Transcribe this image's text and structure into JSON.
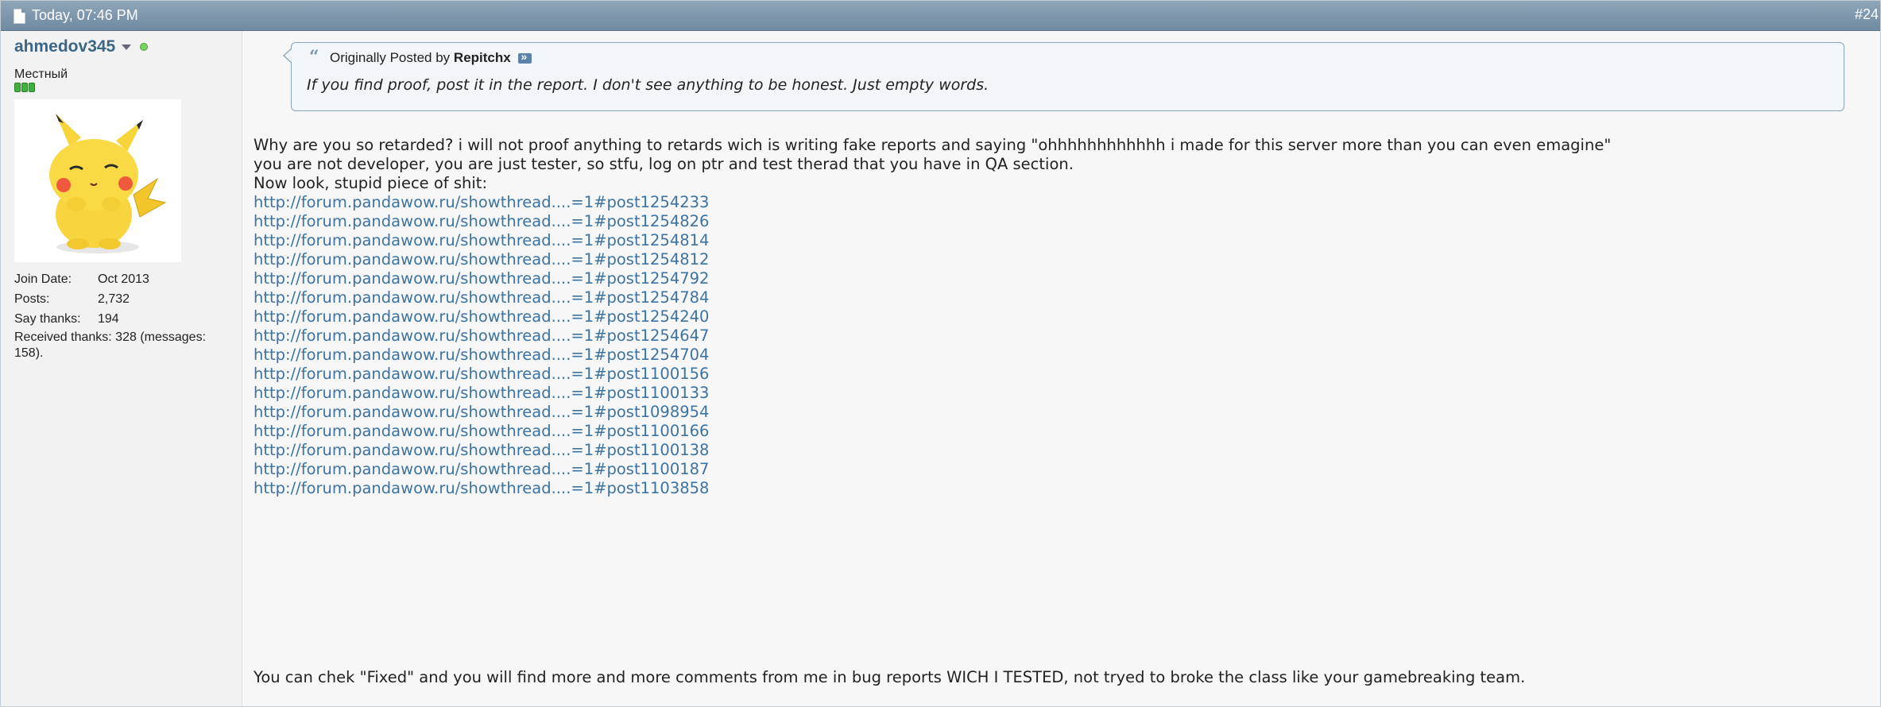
{
  "header": {
    "date": "Today, 07:46 PM",
    "post_number": "#24",
    "date_icon": "document-icon"
  },
  "user": {
    "name": "ahmedov345",
    "title": "Местный",
    "status": "online",
    "stats": {
      "join_date_label": "Join Date:",
      "join_date": "Oct 2013",
      "posts_label": "Posts:",
      "posts": "2,732",
      "say_thanks_label": "Say thanks:",
      "say_thanks": "194",
      "received_thanks": "Received thanks: 328 (messages: 158)."
    },
    "colors": {
      "name": "#3c6685",
      "online": "#7bd163",
      "rep": "#3fb13f"
    }
  },
  "quote": {
    "prefix": "Originally Posted by",
    "author": "Repitchx",
    "text": "If you find proof, post it in the report. I don't see anything to be honest. Just empty words."
  },
  "message": {
    "lines": [
      "Why are you so retarded? i will not proof anything to retards wich is writing fake reports and saying \"ohhhhhhhhhhhh i made for this server more than you can even emagine\"",
      "you are not developer, you are just tester, so stfu, log on ptr and test therad that you have in QA section.",
      "Now look, stupid piece of shit:"
    ],
    "links": [
      "http://forum.pandawow.ru/showthread....=1#post1254233",
      "http://forum.pandawow.ru/showthread....=1#post1254826",
      "http://forum.pandawow.ru/showthread....=1#post1254814",
      "http://forum.pandawow.ru/showthread....=1#post1254812",
      "http://forum.pandawow.ru/showthread....=1#post1254792",
      "http://forum.pandawow.ru/showthread....=1#post1254784",
      "http://forum.pandawow.ru/showthread....=1#post1254240",
      "http://forum.pandawow.ru/showthread....=1#post1254647",
      "http://forum.pandawow.ru/showthread....=1#post1254704",
      "http://forum.pandawow.ru/showthread....=1#post1100156",
      "http://forum.pandawow.ru/showthread....=1#post1100133",
      "http://forum.pandawow.ru/showthread....=1#post1098954",
      "http://forum.pandawow.ru/showthread....=1#post1100166",
      "http://forum.pandawow.ru/showthread....=1#post1100138",
      "http://forum.pandawow.ru/showthread....=1#post1100187",
      "http://forum.pandawow.ru/showthread....=1#post1103858"
    ],
    "closing": "You can chek \"Fixed\" and you will find more and more comments from me in bug reports WICH I TESTED, not tryed to broke the class like your gamebreaking team."
  }
}
